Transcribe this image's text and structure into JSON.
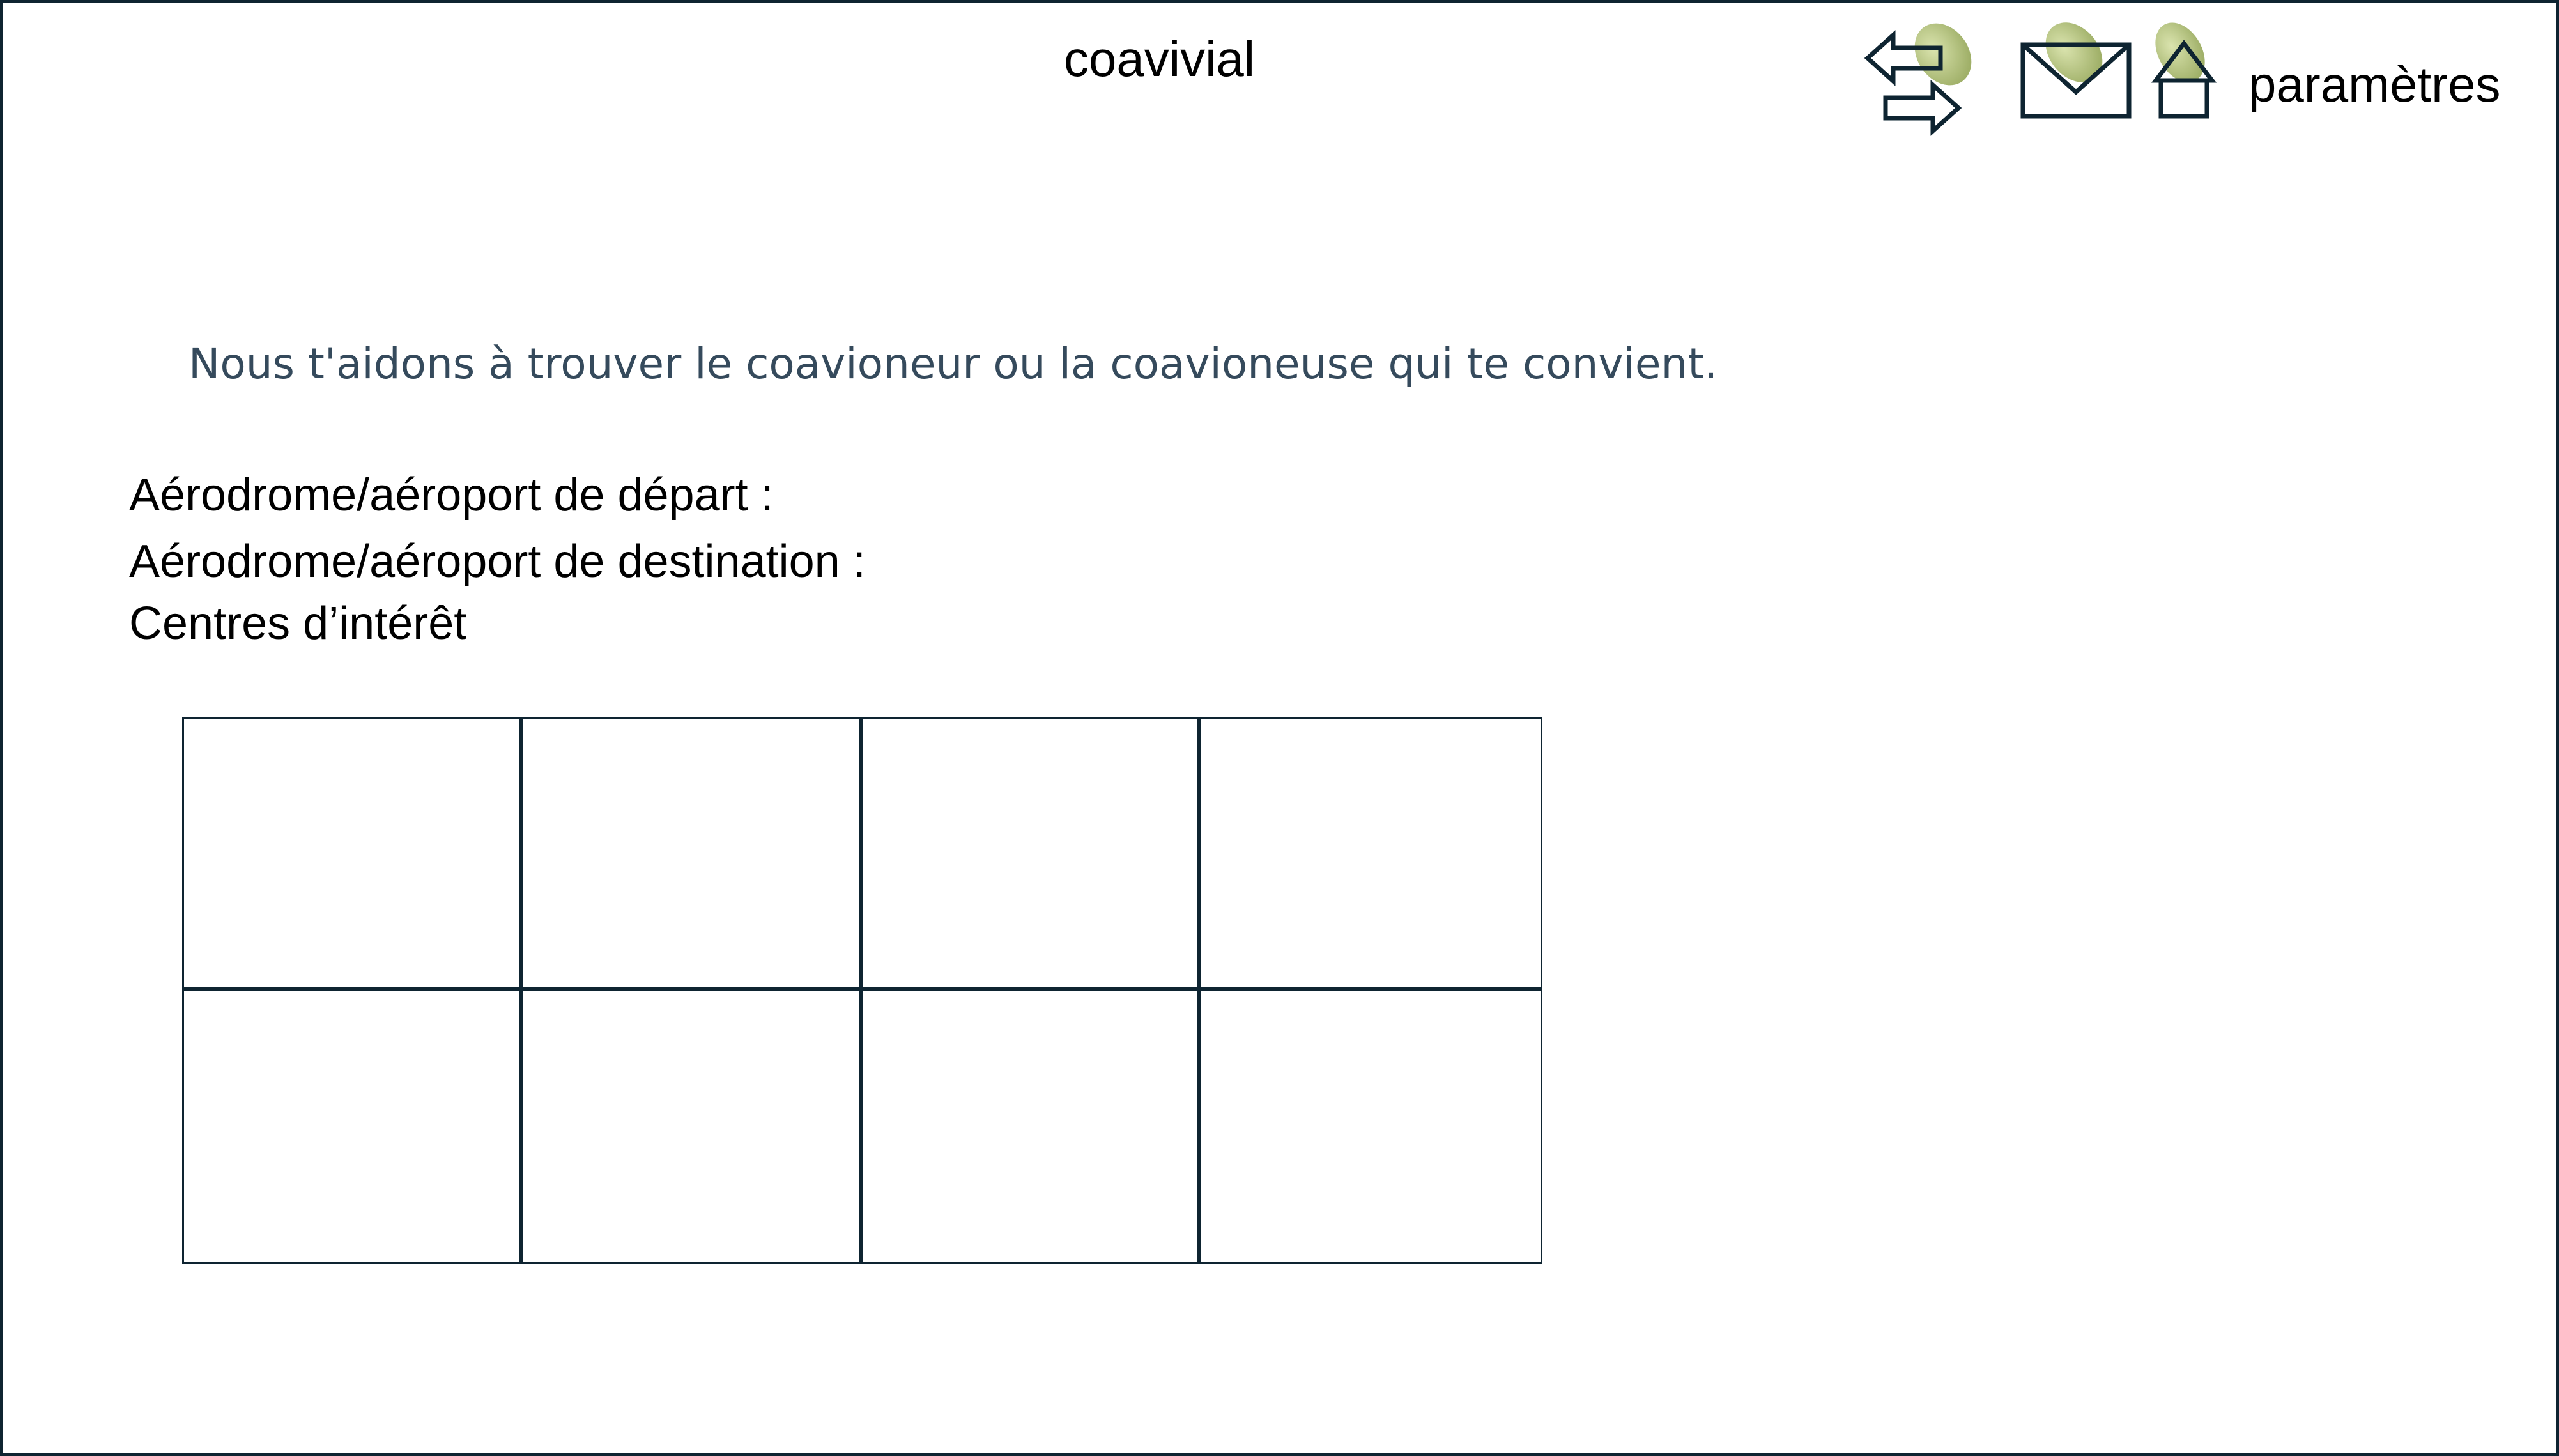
{
  "header": {
    "app_title": "coavivial",
    "settings_label": "paramètres",
    "icons": [
      {
        "name": "swap-arrows-icon"
      },
      {
        "name": "mail-icon"
      },
      {
        "name": "home-icon"
      }
    ]
  },
  "main": {
    "tagline": "Nous t'aidons à trouver le coavioneur ou la coavioneuse qui te convient.",
    "departure_label": "Aérodrome/aéroport de départ :",
    "destination_label": "Aérodrome/aéroport de destination :",
    "interests_label": "Centres d’intérêt",
    "interest_grid": {
      "rows": 2,
      "columns": 4
    }
  },
  "colors": {
    "outline": "#0e2431",
    "tagline": "#354a5c",
    "icon_highlight": "#a8b868"
  }
}
